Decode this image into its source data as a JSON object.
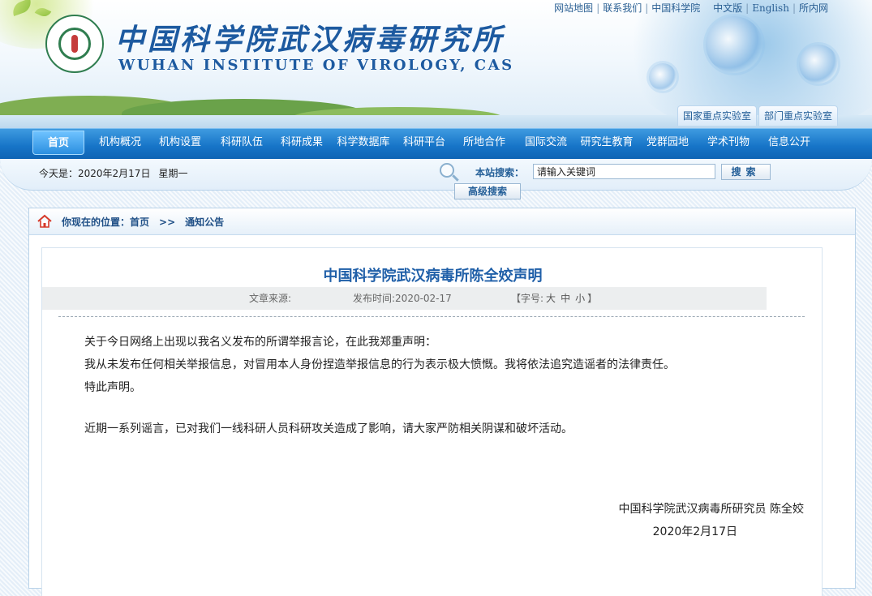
{
  "header": {
    "title_cn": "中国科学院武汉病毒研究所",
    "title_en": "WUHAN INSTITUTE OF VIROLOGY, CAS",
    "top_links": [
      "网站地图",
      "联系我们",
      "中国科学院",
      "中文版",
      "English",
      "所内网"
    ],
    "lab_tabs": [
      "国家重点实验室",
      "部门重点实验室"
    ]
  },
  "nav": {
    "items": [
      "首页",
      "机构概况",
      "机构设置",
      "科研队伍",
      "科研成果",
      "科学数据库",
      "科研平台",
      "所地合作",
      "国际交流",
      "研究生教育",
      "党群园地",
      "学术刊物",
      "信息公开"
    ],
    "active": "首页"
  },
  "infobar": {
    "today_label": "今天是：2020年2月17日",
    "weekday": "星期一",
    "search_label": "本站搜索：",
    "search_value": "请输入关键词",
    "search_button": "搜索",
    "advanced_button": "高级搜索"
  },
  "breadcrumb": {
    "prefix": "你现在的位置：首页",
    "arrow": ">>",
    "current": "通知公告"
  },
  "article": {
    "title": "中国科学院武汉病毒所陈全姣声明",
    "source_label": "文章来源:",
    "time_label": "发布时间:2020-02-17",
    "font_size_label": "【字号:",
    "font_sizes": [
      "大",
      "中",
      "小"
    ],
    "font_size_end": "】",
    "paragraphs": [
      "关于今日网络上出现以我名义发布的所谓举报言论，在此我郑重声明：",
      "我从未发布任何相关举报信息，对冒用本人身份捏造举报信息的行为表示极大愤慨。我将依法追究造谣者的法律责任。",
      "特此声明。",
      "近期一系列谣言，已对我们一线科研人员科研攻关造成了影响，请大家严防相关阴谋和破坏活动。"
    ],
    "signature": "中国科学院武汉病毒所研究员  陈全姣",
    "date": "2020年2月17日"
  },
  "colors": {
    "nav_blue": "#1775c8",
    "title_blue": "#1f5fa8",
    "link_blue": "#245f98"
  }
}
